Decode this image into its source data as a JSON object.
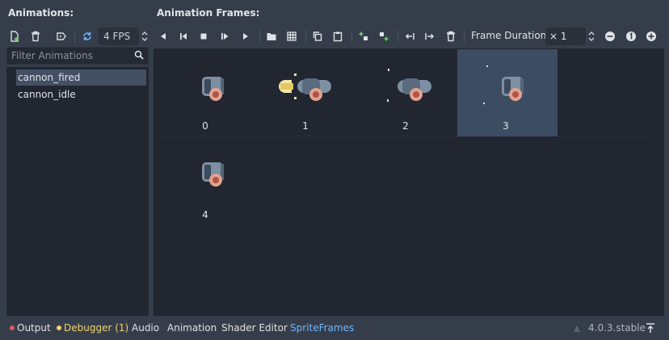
{
  "headers": {
    "animations": "Animations:",
    "frames": "Animation Frames:"
  },
  "left_toolbar": {
    "fps_value": "4 FPS"
  },
  "filter": {
    "placeholder": "Filter Animations"
  },
  "animations": [
    {
      "label": "cannon_fired",
      "selected": true
    },
    {
      "label": "cannon_idle",
      "selected": false
    }
  ],
  "right_toolbar": {
    "frame_duration_label": "Frame Duration:",
    "frame_duration_value": "× 1",
    "icons": [
      "play-backward-icon",
      "play-backward-from-end-icon",
      "stop-icon",
      "play-from-start-icon",
      "play-icon",
      "open-folder-icon",
      "grid-icon",
      "copy-icon",
      "paste-icon",
      "insert-before-icon",
      "insert-after-icon",
      "move-left-icon",
      "move-right-icon",
      "delete-icon",
      "zoom-out-icon",
      "zoom-reset-icon",
      "zoom-in-icon"
    ]
  },
  "frames": [
    {
      "index": "0",
      "selected": false
    },
    {
      "index": "1",
      "selected": false
    },
    {
      "index": "2",
      "selected": false
    },
    {
      "index": "3",
      "selected": true
    },
    {
      "index": "4",
      "selected": false
    }
  ],
  "bottom_bar": {
    "tabs": [
      "Output",
      "Debugger (1)",
      "Audio",
      "Animation",
      "Shader Editor",
      "SpriteFrames"
    ],
    "active_tab": "SpriteFrames",
    "version": "4.0.3.stable"
  },
  "colors": {
    "accent": "#6fb5ff",
    "error_dot": "#e05a5a",
    "warning_dot": "#f0d56c",
    "selection": "#3c4c62"
  }
}
